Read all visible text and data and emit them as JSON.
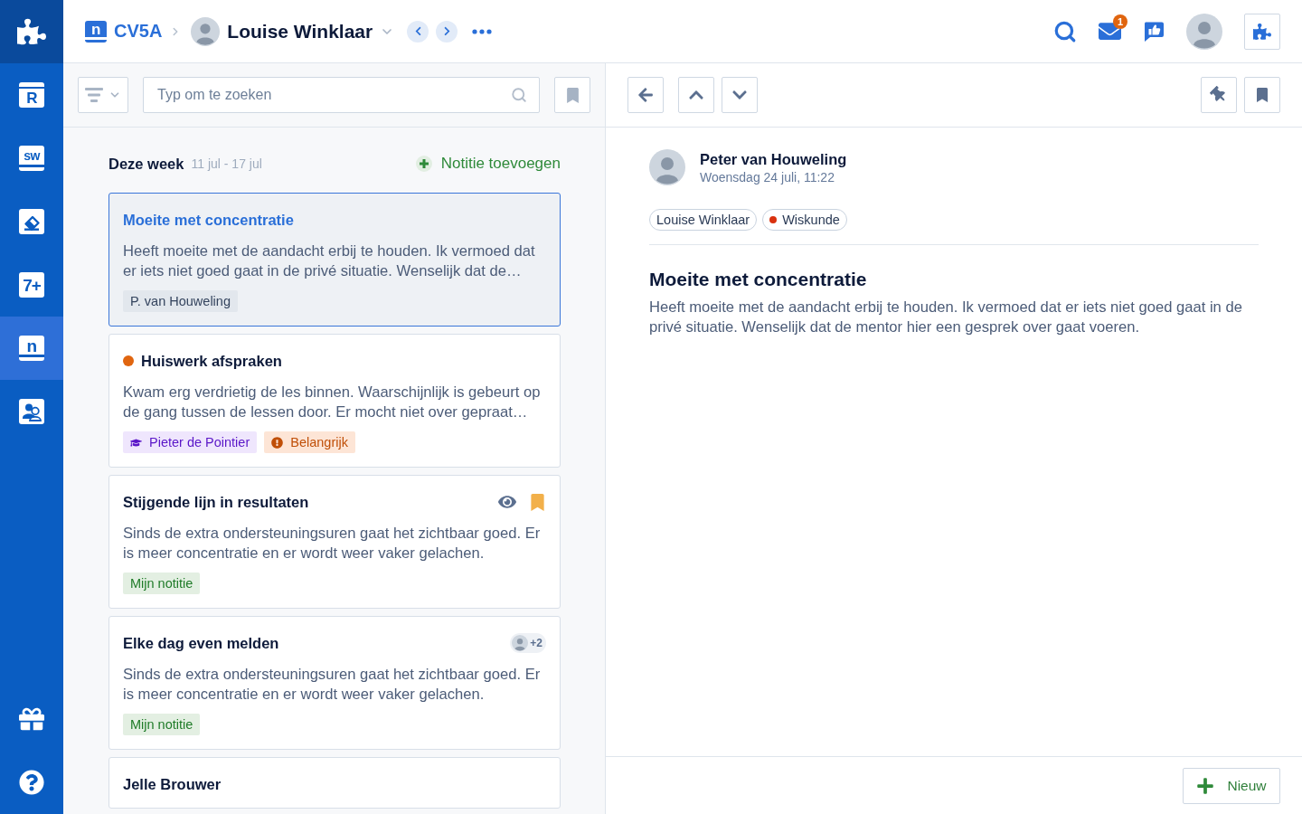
{
  "header": {
    "logo_glyph": "n",
    "class_name": "CV5A",
    "student": "Louise Winklaar",
    "mail_badge": "1"
  },
  "sidebar": {
    "items": [
      {
        "kind": "calendar",
        "glyph": "R",
        "selected": false
      },
      {
        "kind": "book",
        "glyph": "sw",
        "selected": false
      },
      {
        "kind": "icon",
        "selected": false
      },
      {
        "kind": "tile",
        "glyph": "7+",
        "selected": false
      },
      {
        "kind": "book",
        "glyph": "n",
        "selected": true
      },
      {
        "kind": "icon",
        "selected": false
      }
    ]
  },
  "list": {
    "search": {
      "placeholder": "Typ om te zoeken"
    },
    "period": {
      "label": "Deze week",
      "range": "11 jul - 17 jul"
    },
    "add_button": "Notitie toevoegen",
    "notes": [
      {
        "title": "Moeite met concentratie",
        "body": "Heeft moeite met de aandacht erbij te houden. Ik vermoed dat er iets niet goed gaat in de privé situatie. Wenselijk dat de…",
        "selected": true,
        "watched": false,
        "bookmarked": false,
        "tags": [
          {
            "kind": "author",
            "label": "P. van Houweling"
          }
        ]
      },
      {
        "title": "Huiswerk afspraken",
        "color": "#e0650f",
        "body": "Kwam erg verdrietig de les binnen. Waarschijnlijk is gebeurt op de gang tussen de lessen door. Er mocht niet over gepraat…",
        "selected": false,
        "watched": false,
        "bookmarked": false,
        "tags": [
          {
            "kind": "teacher",
            "label": "Pieter de Pointier"
          },
          {
            "kind": "important",
            "label": "Belangrijk"
          }
        ]
      },
      {
        "title": "Stijgende lijn in resultaten",
        "body": "Sinds de extra ondersteuningsuren gaat het zichtbaar goed. Er is meer concentratie en er wordt weer vaker gelachen.",
        "selected": false,
        "watched": true,
        "bookmarked": true,
        "tags": [
          {
            "kind": "own",
            "label": "Mijn notitie"
          }
        ]
      },
      {
        "title": "Elke dag even melden",
        "participants_more": "+2",
        "body": "Sinds de extra ondersteuningsuren gaat het zichtbaar goed. Er is meer concentratie en er wordt weer vaker gelachen.",
        "selected": false,
        "watched": false,
        "bookmarked": false,
        "tags": [
          {
            "kind": "own",
            "label": "Mijn notitie"
          }
        ]
      },
      {
        "title": "Jelle Brouwer",
        "selected": false,
        "watched": false,
        "bookmarked": false
      }
    ]
  },
  "detail": {
    "author": {
      "name": "Peter van Houweling",
      "date": "Woensdag 24 juli, 11:22"
    },
    "chips": [
      {
        "label": "Louise Winklaar"
      },
      {
        "label": "Wiskunde",
        "color": "#d9310e"
      }
    ],
    "title": "Moeite met concentratie",
    "body": "Heeft moeite met de aandacht erbij te houden. Ik vermoed dat er iets niet goed gaat in de privé situatie. Wenselijk dat de mentor hier een gesprek over gaat voeren.",
    "new_button": "Nieuw"
  }
}
